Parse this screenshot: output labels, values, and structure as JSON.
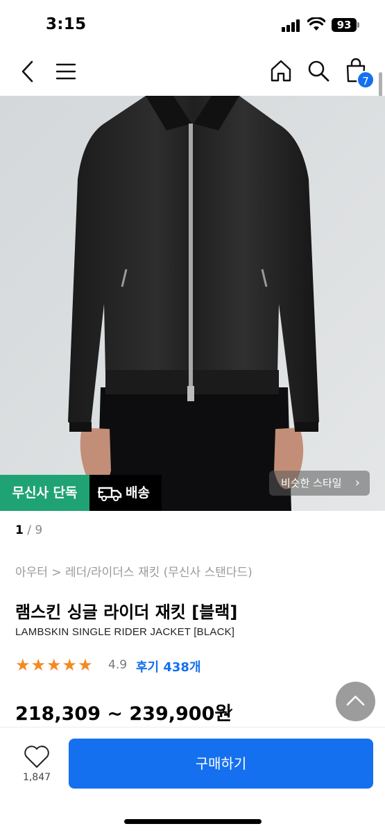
{
  "status_bar": {
    "time": "3:15",
    "battery": "93"
  },
  "nav": {
    "cart_count": "7",
    "icons": [
      "chevron-left-icon",
      "hamburger-menu-icon",
      "home-icon",
      "search-icon",
      "shopping-bag-icon"
    ]
  },
  "product_image": {
    "badge_exclusive": "무신사 단독",
    "badge_delivery": "배송",
    "similar_style": "비슷한 스타일",
    "pager_current": "1",
    "pager_total": "/ 9"
  },
  "product": {
    "breadcrumb": "아우터 > 레더/라이더스 재킷 (무신사 스탠다드)",
    "title_ko": "램스킨 싱글 라이더 재킷 [블랙]",
    "title_en": "LAMBSKIN SINGLE RIDER JACKET [BLACK]",
    "rating_stars": 5,
    "rating_score": "4.9",
    "review_link": "후기 438개",
    "price": "218,309 ~ 239,900원"
  },
  "bottom_bar": {
    "like_count": "1,847",
    "buy_label": "구매하기"
  },
  "colors": {
    "accent": "#1570ef",
    "exclusive_green": "#1fa374",
    "star": "#f5891f"
  }
}
